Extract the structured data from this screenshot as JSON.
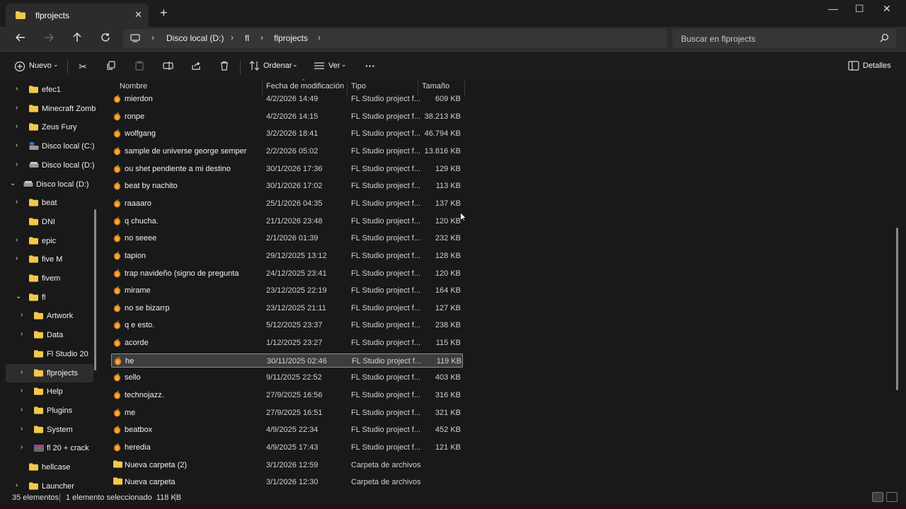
{
  "tab": {
    "title": "flprojects",
    "close": "✕",
    "new": "+"
  },
  "window": {
    "minimize": "—",
    "maximize": "☐",
    "close": "✕"
  },
  "address": {
    "segments": [
      "Disco local (D:)",
      "fl",
      "flprojects"
    ],
    "separator": "›"
  },
  "search": {
    "placeholder": "Buscar en flprojects"
  },
  "toolbar": {
    "new_label": "Nuevo",
    "sort_label": "Ordenar",
    "view_label": "Ver",
    "more_label": "···",
    "details_label": "Detalles"
  },
  "sidebar": {
    "items": [
      {
        "label": "efec1",
        "chevron": "›",
        "icon": "folder-icon"
      },
      {
        "label": "Minecraft Zomb",
        "chevron": "›",
        "icon": "folder-icon"
      },
      {
        "label": "Zeus Fury",
        "chevron": "›",
        "icon": "folder-icon"
      },
      {
        "label": "Disco local (C:)",
        "chevron": "›",
        "icon": "drive-c-icon"
      },
      {
        "label": "Disco local (D:)",
        "chevron": "›",
        "icon": "drive-icon"
      },
      {
        "label": "Disco local (D:)",
        "chevron": "⌄",
        "icon": "drive-icon"
      },
      {
        "label": "beat",
        "chevron": "›",
        "icon": "folder-icon"
      },
      {
        "label": "DNI",
        "chevron": "",
        "icon": "folder-icon"
      },
      {
        "label": "epic",
        "chevron": "›",
        "icon": "folder-icon"
      },
      {
        "label": "five M",
        "chevron": "›",
        "icon": "folder-icon"
      },
      {
        "label": "fivem",
        "chevron": "",
        "icon": "folder-icon"
      },
      {
        "label": "fl",
        "chevron": "⌄",
        "icon": "folder-icon"
      },
      {
        "label": "Artwork",
        "chevron": "›",
        "icon": "folder-icon"
      },
      {
        "label": "Data",
        "chevron": "›",
        "icon": "folder-icon"
      },
      {
        "label": "Fl Studio 20",
        "chevron": "",
        "icon": "folder-icon"
      },
      {
        "label": "flprojects",
        "chevron": "›",
        "icon": "folder-icon",
        "selected": true
      },
      {
        "label": "Help",
        "chevron": "›",
        "icon": "folder-icon"
      },
      {
        "label": "Plugins",
        "chevron": "›",
        "icon": "folder-icon"
      },
      {
        "label": "System",
        "chevron": "›",
        "icon": "folder-icon"
      },
      {
        "label": "fl  20 + crack",
        "chevron": "›",
        "icon": "archive-icon"
      },
      {
        "label": "hellcase",
        "chevron": "",
        "icon": "folder-icon"
      },
      {
        "label": "Launcher",
        "chevron": "›",
        "icon": "folder-icon"
      }
    ]
  },
  "columns": {
    "name": "Nombre",
    "date": "Fecha de modificación",
    "type": "Tipo",
    "size": "Tamaño"
  },
  "files": [
    {
      "name": "mierdon",
      "date": "4/2/2026 14:49",
      "type": "FL Studio project f...",
      "size": "609 KB",
      "kind": "flp"
    },
    {
      "name": "ronpe",
      "date": "4/2/2026 14:15",
      "type": "FL Studio project f...",
      "size": "38.213 KB",
      "kind": "flp"
    },
    {
      "name": "wolfgang",
      "date": "3/2/2026 18:41",
      "type": "FL Studio project f...",
      "size": "46.794 KB",
      "kind": "flp"
    },
    {
      "name": "sample  de universe george semper",
      "date": "2/2/2026 05:02",
      "type": "FL Studio project f...",
      "size": "13.816 KB",
      "kind": "flp"
    },
    {
      "name": "ou shet pendiente a mi destino",
      "date": "30/1/2026 17:36",
      "type": "FL Studio project f...",
      "size": "129 KB",
      "kind": "flp"
    },
    {
      "name": "beat by nachito",
      "date": "30/1/2026 17:02",
      "type": "FL Studio project f...",
      "size": "113 KB",
      "kind": "flp"
    },
    {
      "name": "raaaaro",
      "date": "25/1/2026 04:35",
      "type": "FL Studio project f...",
      "size": "137 KB",
      "kind": "flp"
    },
    {
      "name": "q chucha.",
      "date": "21/1/2026 23:48",
      "type": "FL Studio project f...",
      "size": "120 KB",
      "kind": "flp"
    },
    {
      "name": "no seeee",
      "date": "2/1/2026 01:39",
      "type": "FL Studio project f...",
      "size": "232 KB",
      "kind": "flp"
    },
    {
      "name": "tapion",
      "date": "29/12/2025 13:12",
      "type": "FL Studio project f...",
      "size": "128 KB",
      "kind": "flp"
    },
    {
      "name": "trap navideño (signo de pregunta",
      "date": "24/12/2025 23:41",
      "type": "FL Studio project f...",
      "size": "120 KB",
      "kind": "flp"
    },
    {
      "name": "mirame",
      "date": "23/12/2025 22:19",
      "type": "FL Studio project f...",
      "size": "164 KB",
      "kind": "flp"
    },
    {
      "name": "no se bizarrp",
      "date": "23/12/2025 21:11",
      "type": "FL Studio project f...",
      "size": "127 KB",
      "kind": "flp"
    },
    {
      "name": "q e esto.",
      "date": "5/12/2025 23:37",
      "type": "FL Studio project f...",
      "size": "238 KB",
      "kind": "flp"
    },
    {
      "name": "acorde",
      "date": "1/12/2025 23:27",
      "type": "FL Studio project f...",
      "size": "115 KB",
      "kind": "flp"
    },
    {
      "name": "he",
      "date": "30/11/2025 02:46",
      "type": "FL Studio project f...",
      "size": "119 KB",
      "kind": "flp",
      "selected": true
    },
    {
      "name": "sello",
      "date": "9/11/2025 22:52",
      "type": "FL Studio project f...",
      "size": "403 KB",
      "kind": "flp"
    },
    {
      "name": "technojazz.",
      "date": "27/9/2025 16:56",
      "type": "FL Studio project f...",
      "size": "316 KB",
      "kind": "flp"
    },
    {
      "name": "me",
      "date": "27/9/2025 16:51",
      "type": "FL Studio project f...",
      "size": "321 KB",
      "kind": "flp"
    },
    {
      "name": "beatbox",
      "date": "4/9/2025 22:34",
      "type": "FL Studio project f...",
      "size": "452 KB",
      "kind": "flp"
    },
    {
      "name": "heredia",
      "date": "4/9/2025 17:43",
      "type": "FL Studio project f...",
      "size": "121 KB",
      "kind": "flp"
    },
    {
      "name": "Nueva carpeta (2)",
      "date": "3/1/2026 12:59",
      "type": "Carpeta de archivos",
      "size": "",
      "kind": "folder"
    },
    {
      "name": "Nueva carpeta",
      "date": "3/1/2026 12:30",
      "type": "Carpeta de archivos",
      "size": "",
      "kind": "folder"
    }
  ],
  "status": {
    "count": "35 elementos",
    "selection": "1 elemento seleccionado  118 KB"
  },
  "colors": {
    "folder": "#f2c84b",
    "flp_orange": "#e87a1e",
    "selection_border": "#8f8f8f"
  }
}
